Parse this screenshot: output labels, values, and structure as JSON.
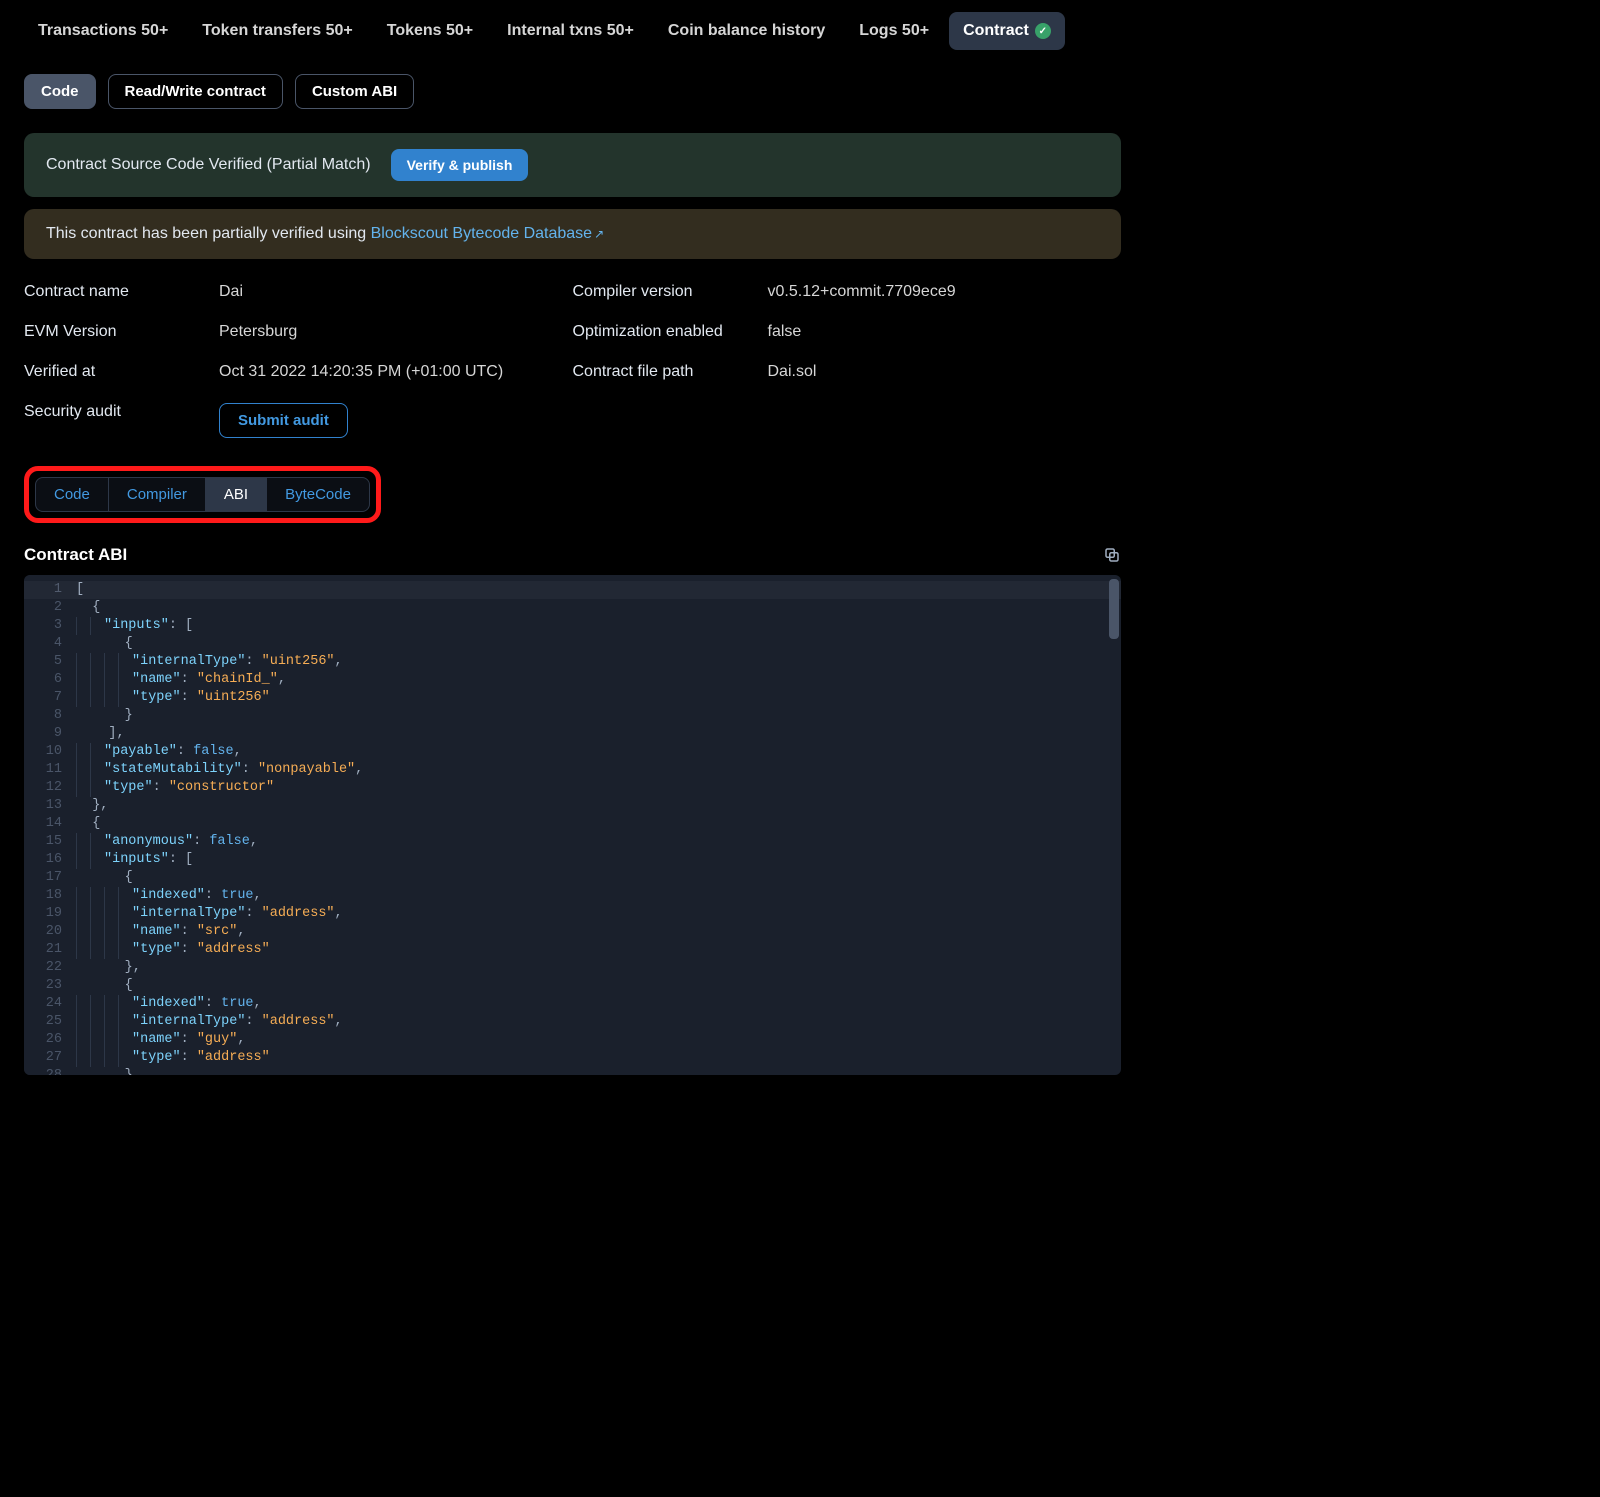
{
  "topTabs": [
    {
      "label": "Transactions",
      "count": "50+"
    },
    {
      "label": "Token transfers",
      "count": "50+"
    },
    {
      "label": "Tokens",
      "count": "50+"
    },
    {
      "label": "Internal txns",
      "count": "50+"
    },
    {
      "label": "Coin balance history",
      "count": ""
    },
    {
      "label": "Logs",
      "count": "50+"
    },
    {
      "label": "Contract",
      "count": "",
      "active": true,
      "badge": true
    }
  ],
  "subTabs": [
    {
      "label": "Code",
      "active": true
    },
    {
      "label": "Read/Write contract"
    },
    {
      "label": "Custom ABI"
    }
  ],
  "verifyAlert": {
    "text": "Contract Source Code Verified (Partial Match)",
    "button": "Verify & publish"
  },
  "dbAlert": {
    "prefix": "This contract has been partially verified using ",
    "linkText": "Blockscout Bytecode Database"
  },
  "details": {
    "rows": [
      {
        "l1": "Contract name",
        "v1": "Dai",
        "l2": "Compiler version",
        "v2": "v0.5.12+commit.7709ece9"
      },
      {
        "l1": "EVM Version",
        "v1": "Petersburg",
        "l2": "Optimization enabled",
        "v2": "false"
      },
      {
        "l1": "Verified at",
        "v1": "Oct 31 2022 14:20:35 PM (+01:00 UTC)",
        "l2": "Contract file path",
        "v2": "Dai.sol"
      }
    ],
    "auditLabel": "Security audit",
    "auditButton": "Submit audit"
  },
  "segTabs": [
    {
      "label": "Code"
    },
    {
      "label": "Compiler"
    },
    {
      "label": "ABI",
      "active": true
    },
    {
      "label": "ByteCode"
    }
  ],
  "sectionTitle": "Contract ABI",
  "codeLines": [
    [
      [
        "p",
        "["
      ]
    ],
    [
      [
        "p",
        "  {"
      ]
    ],
    [
      [
        "p",
        "    "
      ],
      [
        "k",
        "\"inputs\""
      ],
      [
        "p",
        ": ["
      ]
    ],
    [
      [
        "p",
        "      {"
      ]
    ],
    [
      [
        "p",
        "        "
      ],
      [
        "k",
        "\"internalType\""
      ],
      [
        "p",
        ": "
      ],
      [
        "s",
        "\"uint256\""
      ],
      [
        "p",
        ","
      ]
    ],
    [
      [
        "p",
        "        "
      ],
      [
        "k",
        "\"name\""
      ],
      [
        "p",
        ": "
      ],
      [
        "s",
        "\"chainId_\""
      ],
      [
        "p",
        ","
      ]
    ],
    [
      [
        "p",
        "        "
      ],
      [
        "k",
        "\"type\""
      ],
      [
        "p",
        ": "
      ],
      [
        "s",
        "\"uint256\""
      ]
    ],
    [
      [
        "p",
        "      }"
      ]
    ],
    [
      [
        "p",
        "    ],"
      ]
    ],
    [
      [
        "p",
        "    "
      ],
      [
        "k",
        "\"payable\""
      ],
      [
        "p",
        ": "
      ],
      [
        "b",
        "false"
      ],
      [
        "p",
        ","
      ]
    ],
    [
      [
        "p",
        "    "
      ],
      [
        "k",
        "\"stateMutability\""
      ],
      [
        "p",
        ": "
      ],
      [
        "s",
        "\"nonpayable\""
      ],
      [
        "p",
        ","
      ]
    ],
    [
      [
        "p",
        "    "
      ],
      [
        "k",
        "\"type\""
      ],
      [
        "p",
        ": "
      ],
      [
        "s",
        "\"constructor\""
      ]
    ],
    [
      [
        "p",
        "  },"
      ]
    ],
    [
      [
        "p",
        "  {"
      ]
    ],
    [
      [
        "p",
        "    "
      ],
      [
        "k",
        "\"anonymous\""
      ],
      [
        "p",
        ": "
      ],
      [
        "b",
        "false"
      ],
      [
        "p",
        ","
      ]
    ],
    [
      [
        "p",
        "    "
      ],
      [
        "k",
        "\"inputs\""
      ],
      [
        "p",
        ": ["
      ]
    ],
    [
      [
        "p",
        "      {"
      ]
    ],
    [
      [
        "p",
        "        "
      ],
      [
        "k",
        "\"indexed\""
      ],
      [
        "p",
        ": "
      ],
      [
        "b",
        "true"
      ],
      [
        "p",
        ","
      ]
    ],
    [
      [
        "p",
        "        "
      ],
      [
        "k",
        "\"internalType\""
      ],
      [
        "p",
        ": "
      ],
      [
        "s",
        "\"address\""
      ],
      [
        "p",
        ","
      ]
    ],
    [
      [
        "p",
        "        "
      ],
      [
        "k",
        "\"name\""
      ],
      [
        "p",
        ": "
      ],
      [
        "s",
        "\"src\""
      ],
      [
        "p",
        ","
      ]
    ],
    [
      [
        "p",
        "        "
      ],
      [
        "k",
        "\"type\""
      ],
      [
        "p",
        ": "
      ],
      [
        "s",
        "\"address\""
      ]
    ],
    [
      [
        "p",
        "      },"
      ]
    ],
    [
      [
        "p",
        "      {"
      ]
    ],
    [
      [
        "p",
        "        "
      ],
      [
        "k",
        "\"indexed\""
      ],
      [
        "p",
        ": "
      ],
      [
        "b",
        "true"
      ],
      [
        "p",
        ","
      ]
    ],
    [
      [
        "p",
        "        "
      ],
      [
        "k",
        "\"internalType\""
      ],
      [
        "p",
        ": "
      ],
      [
        "s",
        "\"address\""
      ],
      [
        "p",
        ","
      ]
    ],
    [
      [
        "p",
        "        "
      ],
      [
        "k",
        "\"name\""
      ],
      [
        "p",
        ": "
      ],
      [
        "s",
        "\"guy\""
      ],
      [
        "p",
        ","
      ]
    ],
    [
      [
        "p",
        "        "
      ],
      [
        "k",
        "\"type\""
      ],
      [
        "p",
        ": "
      ],
      [
        "s",
        "\"address\""
      ]
    ],
    [
      [
        "p",
        "      },"
      ]
    ]
  ]
}
